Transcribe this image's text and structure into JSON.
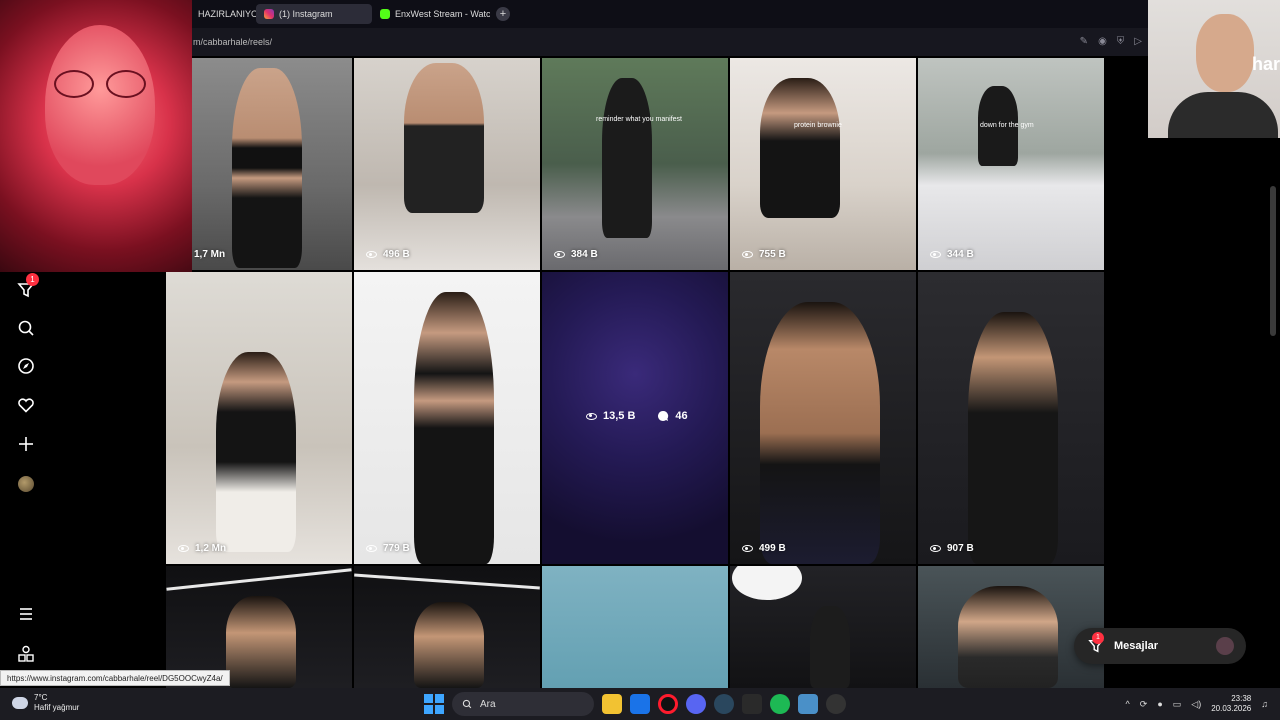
{
  "tabs": [
    {
      "label": "HAZIRLANIYORUZ",
      "active": false
    },
    {
      "label": "(1) Instagram",
      "active": true
    },
    {
      "label": "EnxWest Stream - Watch Live",
      "active": false
    }
  ],
  "address": "m/cabbarhale/reels/",
  "sidebar": {
    "notification_count": "1"
  },
  "webcam_right_text": "har",
  "grid": [
    {
      "views": "1,7 Mn"
    },
    {
      "views": "496 B"
    },
    {
      "views": "384 B",
      "caption": "reminder what you manifest"
    },
    {
      "views": "755 B",
      "caption": "protein brownie"
    },
    {
      "views": "344 B",
      "caption": "down for the gym"
    },
    {
      "views": "1,2 Mn"
    },
    {
      "views": "779 B"
    },
    {
      "views": "13,5 B",
      "comments": "46"
    },
    {
      "views": "499 B"
    },
    {
      "views": "907 B"
    }
  ],
  "messages": {
    "label": "Mesajlar",
    "badge": "1"
  },
  "status_url": "https://www.instagram.com/cabbarhale/reel/DG5OOCwyZ4a/",
  "taskbar": {
    "weather_temp": "7°C",
    "weather_desc": "Hafif yağmur",
    "search_label": "Ara",
    "time": "23:38",
    "date": "20.03.2026"
  }
}
